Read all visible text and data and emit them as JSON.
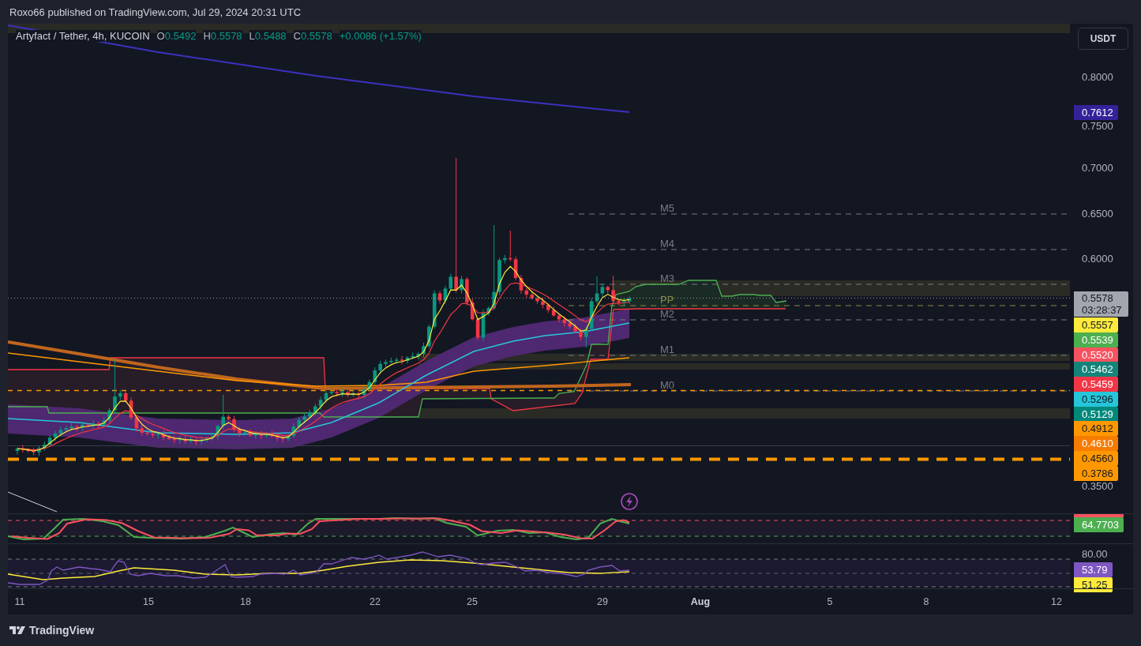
{
  "header": {
    "text": "Roxo66 published on TradingView.com, Jul 29, 2024 20:31 UTC"
  },
  "legend": {
    "symbol": "Artyfact / Tether, 4h, KUCOIN",
    "values": [
      {
        "label": "O",
        "value": "0.5492"
      },
      {
        "label": "H",
        "value": "0.5578"
      },
      {
        "label": "L",
        "value": "0.5488"
      },
      {
        "label": "C",
        "value": "0.5578"
      }
    ],
    "change": "+0.0086 (+1.57%)"
  },
  "currency_button": {
    "label": "USDT"
  },
  "pivot_levels": [
    {
      "label": "M5",
      "kind": "level"
    },
    {
      "label": "M4",
      "kind": "level"
    },
    {
      "label": "M3",
      "kind": "level"
    },
    {
      "label": "PP",
      "kind": "pivot"
    },
    {
      "label": "M2",
      "kind": "level"
    },
    {
      "label": "M1",
      "kind": "level"
    },
    {
      "label": "M0",
      "kind": "level"
    }
  ],
  "price_axis": {
    "ticks": [
      "0.8000",
      "0.7500",
      "0.7000",
      "0.6500",
      "0.6000",
      "0.3500"
    ],
    "tags": [
      {
        "text": "0.7612",
        "color": "#34229a"
      },
      {
        "text": "0.5578",
        "countdown": "03:28:37",
        "color": "#a3a6af"
      },
      {
        "text": "0.5557",
        "color": "#ffeb3b"
      },
      {
        "text": "0.5539",
        "color": "#4caf50"
      },
      {
        "text": "0.5520",
        "color": "#f7525f"
      },
      {
        "text": "0.5462",
        "color": "#14847a"
      },
      {
        "text": "0.5459",
        "color": "#f23645"
      },
      {
        "text": "0.5296",
        "color": "#26c6da"
      },
      {
        "text": "0.5129",
        "color": "#00897b"
      },
      {
        "text": "0.4912",
        "color": "#ff9800"
      },
      {
        "text": "0.4610",
        "color": "#f57c00"
      },
      {
        "text": "0.4560",
        "color": "#ff9800"
      },
      {
        "text": "0.3786",
        "color": "#ff9800"
      }
    ]
  },
  "stochastic_axis": {
    "tags": [
      {
        "color": "#f7525f"
      },
      {
        "text": "64.7703",
        "color": "#4caf50"
      }
    ]
  },
  "rsi_axis": {
    "ticks": [
      "80.00"
    ],
    "tags": [
      {
        "text": "53.79",
        "color": "#7e57c2"
      },
      {
        "text": "51.25",
        "color": "#ffeb3b"
      }
    ]
  },
  "time_axis": {
    "labels": [
      {
        "text": "11",
        "kind": "day"
      },
      {
        "text": "15",
        "kind": "day"
      },
      {
        "text": "18",
        "kind": "day"
      },
      {
        "text": "22",
        "kind": "day"
      },
      {
        "text": "25",
        "kind": "day"
      },
      {
        "text": "29",
        "kind": "day"
      },
      {
        "text": "Aug",
        "kind": "month"
      },
      {
        "text": "5",
        "kind": "day"
      },
      {
        "text": "8",
        "kind": "day"
      },
      {
        "text": "12",
        "kind": "day"
      }
    ]
  },
  "footer": {
    "logo_text": "TradingView"
  }
}
